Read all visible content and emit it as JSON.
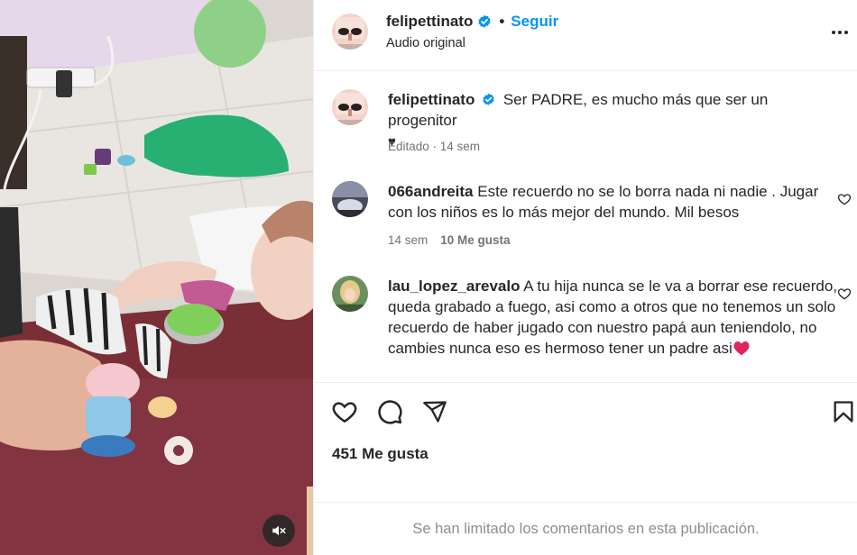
{
  "post": {
    "author": "felipettinato",
    "follow_label": "Seguir",
    "separator": "•",
    "audio": "Audio original",
    "caption": "Ser PADRE, es mucho más que ser un progenitor",
    "caption_heart": "♥",
    "caption_meta": "Editado · 14 sem"
  },
  "comments": [
    {
      "user": "066andreita",
      "text": "Este recuerdo no se lo borra nada ni nadie . Jugar con los niños es lo más mejor del mundo. Mil besos",
      "time": "14 sem",
      "likes": "10 Me gusta"
    },
    {
      "user": "lau_lopez_arevalo",
      "text": "A tu hija nunca se le va a borrar ese recuerdo, queda grabado a fuego, asi como a otros que no tenemos un solo recuerdo de haber jugado con nuestro papá aun teniendolo, no cambies nunca eso es hermoso tener un padre asi",
      "emoji": "❤️"
    }
  ],
  "likes_total": "451 Me gusta",
  "comments_limited": "Se han limitado los comentarios en esta publicación.",
  "colors": {
    "accent": "#0095f6",
    "verified": "#0095f6",
    "muted": "#737373",
    "border": "#efefef"
  },
  "icons": [
    "more-options-icon",
    "verified-badge-icon",
    "like-icon",
    "comment-icon",
    "share-icon",
    "save-icon",
    "mute-icon",
    "small-heart-icon"
  ]
}
